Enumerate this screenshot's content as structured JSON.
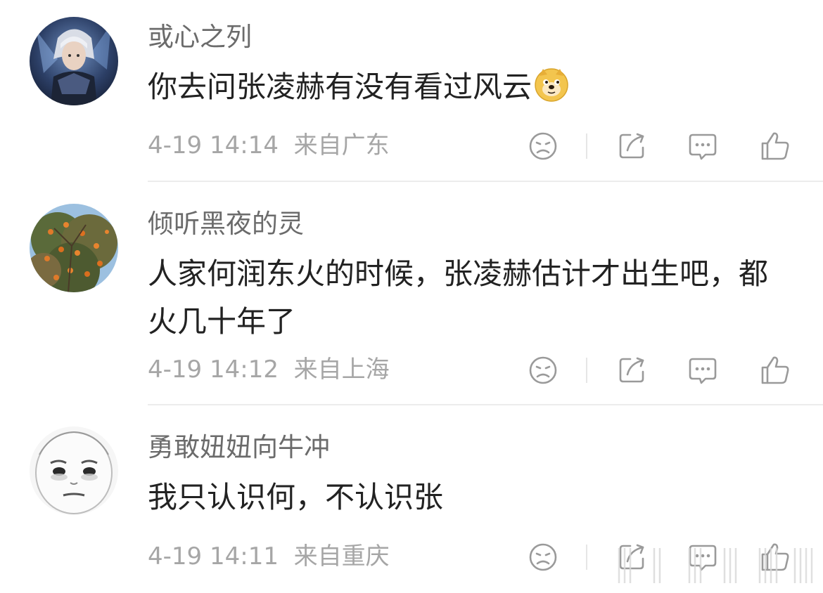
{
  "comments": [
    {
      "username": "或心之列",
      "text": "你去问张凌赫有没有看过风云",
      "emoji": "doge-emoji",
      "timestamp": "4-19 14:14",
      "location": "来自广东",
      "avatar": "anime-warrior-avatar"
    },
    {
      "username": "倾听黑夜的灵",
      "text": "人家何润东火的时候，张凌赫估计才出生吧，都火几十年了",
      "timestamp": "4-19 14:12",
      "location": "来自上海",
      "avatar": "persimmon-tree-avatar"
    },
    {
      "username": "勇敢妞妞向牛冲",
      "text": "我只认识何，不认识张",
      "timestamp": "4-19 14:11",
      "location": "来自重庆",
      "avatar": "sketch-face-avatar"
    }
  ],
  "actions": {
    "dislike": "sad-face-icon",
    "share": "share-icon",
    "comment": "comment-bubble-icon",
    "like": "thumbs-up-icon"
  },
  "colors": {
    "username": "#6b6b6b",
    "text": "#222222",
    "meta": "#a6a6a6",
    "icon": "#9a9a9a",
    "divider": "#ececec"
  }
}
